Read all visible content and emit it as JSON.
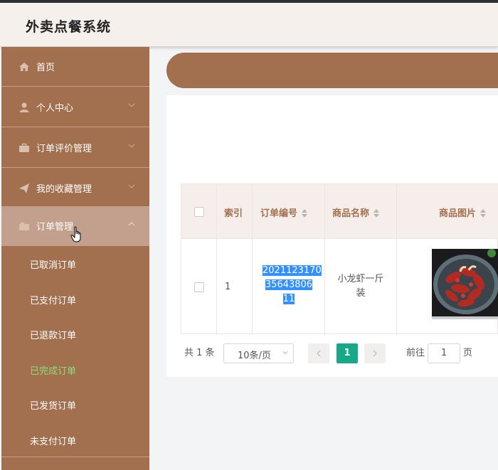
{
  "app": {
    "title": "外卖点餐系统"
  },
  "sidebar": {
    "items": [
      {
        "label": "首页",
        "icon": "home-icon"
      },
      {
        "label": "个人中心",
        "icon": "user-icon"
      },
      {
        "label": "订单评价管理",
        "icon": "briefcase-icon"
      },
      {
        "label": "我的收藏管理",
        "icon": "send-icon"
      },
      {
        "label": "订单管理",
        "icon": "folder-hand-icon"
      }
    ],
    "sub_items": [
      "已取消订单",
      "已支付订单",
      "已退款订单",
      "已完成订单",
      "已发货订单",
      "未支付订单"
    ],
    "current_sub": "已完成订单"
  },
  "table": {
    "headers": {
      "index": "索引",
      "order_no": "订单编号",
      "product_name": "商品名称",
      "product_image": "商品图片"
    },
    "rows": [
      {
        "index": "1",
        "order_no": "2021123170356438061 1",
        "order_no_lines": [
          "2021123170",
          "35643806",
          "11"
        ],
        "product_name_lines": [
          "小龙虾一斤",
          "装"
        ]
      }
    ]
  },
  "pagination": {
    "total": "共 1 条",
    "page_size": "10条/页",
    "current_page": "1",
    "goto_label": "前往",
    "goto_value": "1",
    "page_unit": "页"
  },
  "colors": {
    "sidebar": "#a3704f",
    "accent": "#15a98a",
    "active_sub": "#8be07a"
  }
}
